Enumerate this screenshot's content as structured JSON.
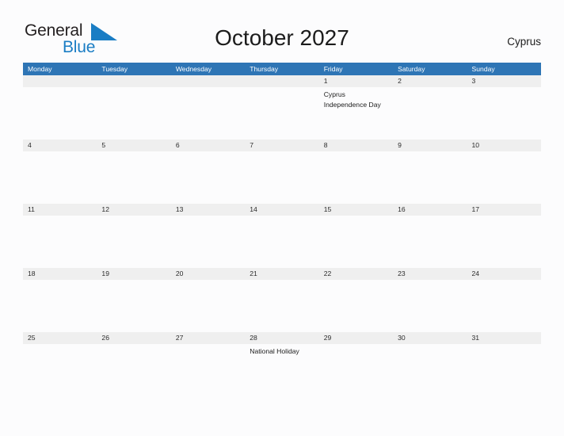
{
  "brand": {
    "word_one": "General",
    "word_two": "Blue",
    "flag_icon": "blue-triangle-flag",
    "accent_color": "#1a7dc4"
  },
  "header": {
    "title": "October 2027",
    "country": "Cyprus"
  },
  "colors": {
    "header_blue": "#2e75b5",
    "day_strip_gray": "#efefef",
    "page_background": "#fcfcfd",
    "text": "#1c1c1c"
  },
  "calendar": {
    "weekdays": [
      "Monday",
      "Tuesday",
      "Wednesday",
      "Thursday",
      "Friday",
      "Saturday",
      "Sunday"
    ],
    "weeks": [
      {
        "rule": false,
        "days": [
          {
            "number": "",
            "events": []
          },
          {
            "number": "",
            "events": []
          },
          {
            "number": "",
            "events": []
          },
          {
            "number": "",
            "events": []
          },
          {
            "number": "1",
            "events": [
              "Cyprus Independence Day"
            ]
          },
          {
            "number": "2",
            "events": []
          },
          {
            "number": "3",
            "events": []
          }
        ]
      },
      {
        "rule": true,
        "days": [
          {
            "number": "4",
            "events": []
          },
          {
            "number": "5",
            "events": []
          },
          {
            "number": "6",
            "events": []
          },
          {
            "number": "7",
            "events": []
          },
          {
            "number": "8",
            "events": []
          },
          {
            "number": "9",
            "events": []
          },
          {
            "number": "10",
            "events": []
          }
        ]
      },
      {
        "rule": true,
        "days": [
          {
            "number": "11",
            "events": []
          },
          {
            "number": "12",
            "events": []
          },
          {
            "number": "13",
            "events": []
          },
          {
            "number": "14",
            "events": []
          },
          {
            "number": "15",
            "events": []
          },
          {
            "number": "16",
            "events": []
          },
          {
            "number": "17",
            "events": []
          }
        ]
      },
      {
        "rule": true,
        "days": [
          {
            "number": "18",
            "events": []
          },
          {
            "number": "19",
            "events": []
          },
          {
            "number": "20",
            "events": []
          },
          {
            "number": "21",
            "events": []
          },
          {
            "number": "22",
            "events": []
          },
          {
            "number": "23",
            "events": []
          },
          {
            "number": "24",
            "events": []
          }
        ]
      },
      {
        "rule": true,
        "days": [
          {
            "number": "25",
            "events": []
          },
          {
            "number": "26",
            "events": []
          },
          {
            "number": "27",
            "events": []
          },
          {
            "number": "28",
            "events": [
              "National Holiday"
            ]
          },
          {
            "number": "29",
            "events": []
          },
          {
            "number": "30",
            "events": []
          },
          {
            "number": "31",
            "events": []
          }
        ]
      }
    ]
  }
}
